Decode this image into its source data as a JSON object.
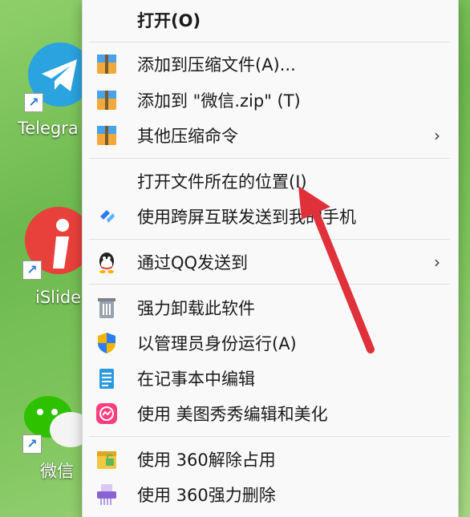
{
  "desktop": {
    "icons": [
      {
        "label": "Telegra",
        "name": "telegram-app-icon"
      },
      {
        "label": "iSlide",
        "name": "islide-app-icon"
      },
      {
        "label": "微信",
        "name": "wechat-app-icon"
      }
    ]
  },
  "context_menu": {
    "items": [
      {
        "label": "打开(O)"
      },
      {
        "label": "添加到压缩文件(A)..."
      },
      {
        "label": "添加到 \"微信.zip\" (T)"
      },
      {
        "label": "其他压缩命令",
        "arrow": "›"
      },
      {
        "label": "打开文件所在的位置(I)"
      },
      {
        "label": "使用跨屏互联发送到我的手机"
      },
      {
        "label": "通过QQ发送到",
        "arrow": "›"
      },
      {
        "label": "强力卸载此软件"
      },
      {
        "label": "以管理员身份运行(A)"
      },
      {
        "label": "在记事本中编辑"
      },
      {
        "label": "使用 美图秀秀编辑和美化"
      },
      {
        "label": "使用 360解除占用"
      },
      {
        "label": "使用 360强力删除"
      }
    ]
  },
  "colors": {
    "menu_bg": "#f9f9f9",
    "arrow_red": "#e0313a",
    "desktop_green": "#7cc45a"
  }
}
